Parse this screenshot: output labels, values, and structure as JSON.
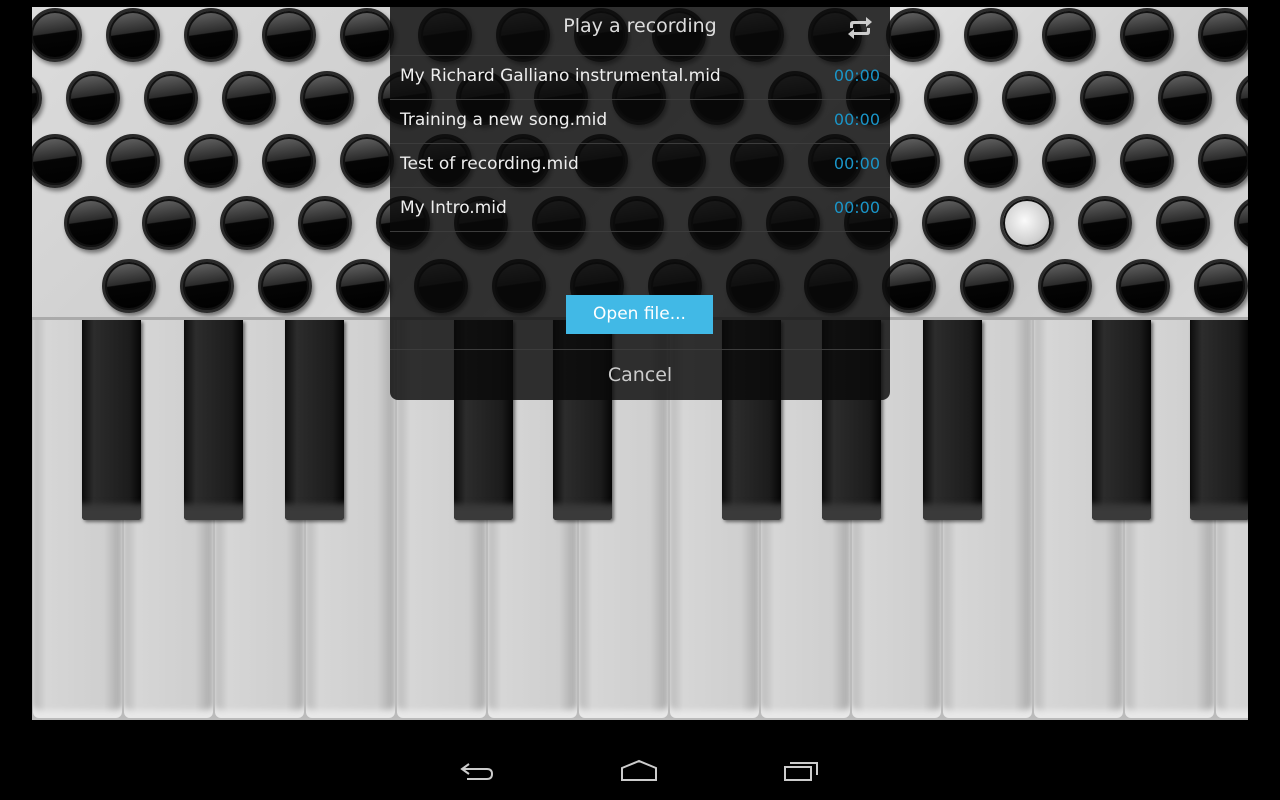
{
  "dialog": {
    "title": "Play a recording",
    "refresh_icon": "repeat-icon",
    "recordings": [
      {
        "name": "My Richard Galliano instrumental.mid",
        "duration": "00:00"
      },
      {
        "name": "Training a new song.mid",
        "duration": "00:00"
      },
      {
        "name": "Test of recording.mid",
        "duration": "00:00"
      },
      {
        "name": "My Intro.mid",
        "duration": "00:00"
      }
    ],
    "open_file_label": "Open file...",
    "cancel_label": "Cancel"
  },
  "colors": {
    "accent": "#41b9e6",
    "duration_text": "#1a95c8"
  },
  "nav": {
    "icons": [
      "back-icon",
      "home-icon",
      "recent-apps-icon"
    ]
  }
}
